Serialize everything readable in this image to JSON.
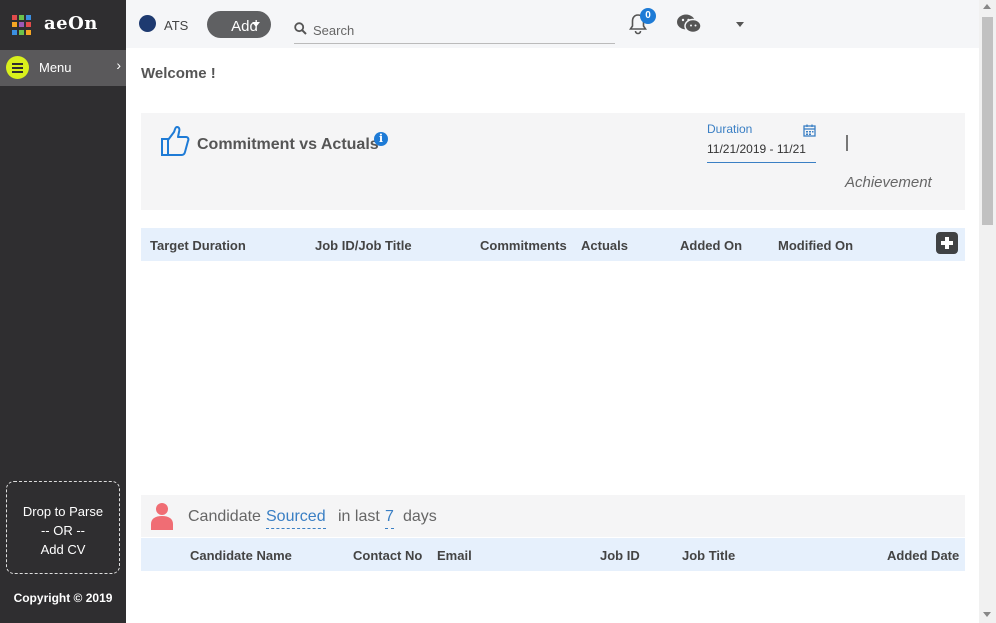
{
  "app": {
    "logo": "aeOn"
  },
  "sidebar": {
    "menu_label": "Menu",
    "drop_line1": "Drop to Parse",
    "drop_line2": "-- OR --",
    "drop_line3": "Add CV",
    "copyright": "Copyright © 2019"
  },
  "topbar": {
    "module": "ATS",
    "add_label": "Add",
    "search_placeholder": "Search",
    "notification_count": "0"
  },
  "main": {
    "welcome": "Welcome !",
    "commitment": {
      "title": "Commitment vs Actuals",
      "duration_label": "Duration",
      "duration_value": "11/21/2019 - 11/21",
      "achievement_label": "Achievement",
      "columns": [
        "Target Duration",
        "Job ID/Job Title",
        "Commitments",
        "Actuals",
        "Added On",
        "Modified On"
      ]
    },
    "candidate": {
      "prefix": "Candidate",
      "status": "Sourced",
      "middle": "in last",
      "days_value": "7",
      "suffix": "days",
      "columns": [
        "Candidate Name",
        "Contact No",
        "Email",
        "Job ID",
        "Job Title",
        "Added Date"
      ]
    }
  },
  "colors": {
    "sidebar_bg": "#2f2e30",
    "menu_accent": "#d9f01c",
    "link_blue": "#3a7fc4",
    "header_row_bg": "#e6f0fc",
    "candidate_icon": "#f06d74"
  }
}
